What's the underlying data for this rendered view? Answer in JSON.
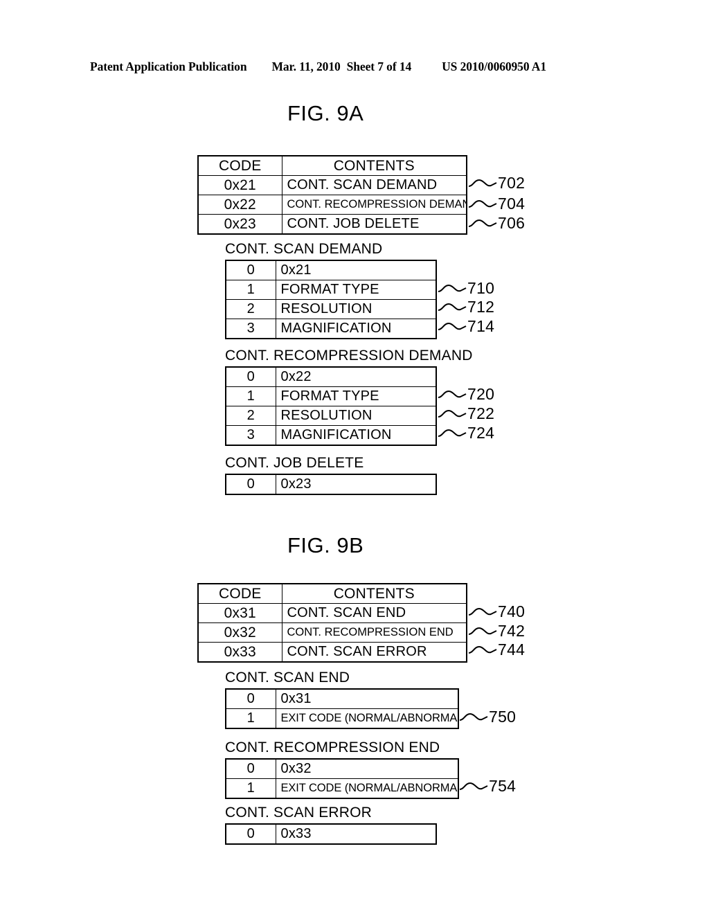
{
  "header": {
    "publication": "Patent Application Publication",
    "date": "Mar. 11, 2010",
    "sheet": "Sheet 7 of 14",
    "patent_number": "US 2010/0060950 A1"
  },
  "figures": [
    {
      "title": "FIG. 9A",
      "code_table": {
        "headers": [
          "CODE",
          "CONTENTS"
        ],
        "rows": [
          {
            "code": "0x21",
            "contents": "CONT. SCAN DEMAND",
            "ref": "702"
          },
          {
            "code": "0x22",
            "contents": "CONT. RECOMPRESSION DEMAND",
            "ref": "704"
          },
          {
            "code": "0x23",
            "contents": "CONT. JOB DELETE",
            "ref": "706"
          }
        ]
      },
      "detail_tables": [
        {
          "caption": "CONT. SCAN DEMAND",
          "rows": [
            {
              "index": "0",
              "value": "0x21",
              "ref": ""
            },
            {
              "index": "1",
              "value": "FORMAT TYPE",
              "ref": "710"
            },
            {
              "index": "2",
              "value": "RESOLUTION",
              "ref": "712"
            },
            {
              "index": "3",
              "value": "MAGNIFICATION",
              "ref": "714"
            }
          ]
        },
        {
          "caption": "CONT. RECOMPRESSION DEMAND",
          "rows": [
            {
              "index": "0",
              "value": "0x22",
              "ref": ""
            },
            {
              "index": "1",
              "value": "FORMAT TYPE",
              "ref": "720"
            },
            {
              "index": "2",
              "value": "RESOLUTION",
              "ref": "722"
            },
            {
              "index": "3",
              "value": "MAGNIFICATION",
              "ref": "724"
            }
          ]
        },
        {
          "caption": "CONT. JOB DELETE",
          "rows": [
            {
              "index": "0",
              "value": "0x23",
              "ref": ""
            }
          ]
        }
      ]
    },
    {
      "title": "FIG. 9B",
      "code_table": {
        "headers": [
          "CODE",
          "CONTENTS"
        ],
        "rows": [
          {
            "code": "0x31",
            "contents": "CONT. SCAN END",
            "ref": "740"
          },
          {
            "code": "0x32",
            "contents": "CONT. RECOMPRESSION END",
            "ref": "742"
          },
          {
            "code": "0x33",
            "contents": "CONT. SCAN ERROR",
            "ref": "744"
          }
        ]
      },
      "detail_tables": [
        {
          "caption": "CONT. SCAN END",
          "rows": [
            {
              "index": "0",
              "value": "0x31",
              "ref": ""
            },
            {
              "index": "1",
              "value": "EXIT CODE (NORMAL/ABNORMAL)",
              "ref": "750"
            }
          ]
        },
        {
          "caption": "CONT. RECOMPRESSION END",
          "rows": [
            {
              "index": "0",
              "value": "0x32",
              "ref": ""
            },
            {
              "index": "1",
              "value": "EXIT CODE (NORMAL/ABNORMAL)",
              "ref": "754"
            }
          ]
        },
        {
          "caption": "CONT. SCAN ERROR",
          "rows": [
            {
              "index": "0",
              "value": "0x33",
              "ref": ""
            }
          ]
        }
      ]
    }
  ]
}
